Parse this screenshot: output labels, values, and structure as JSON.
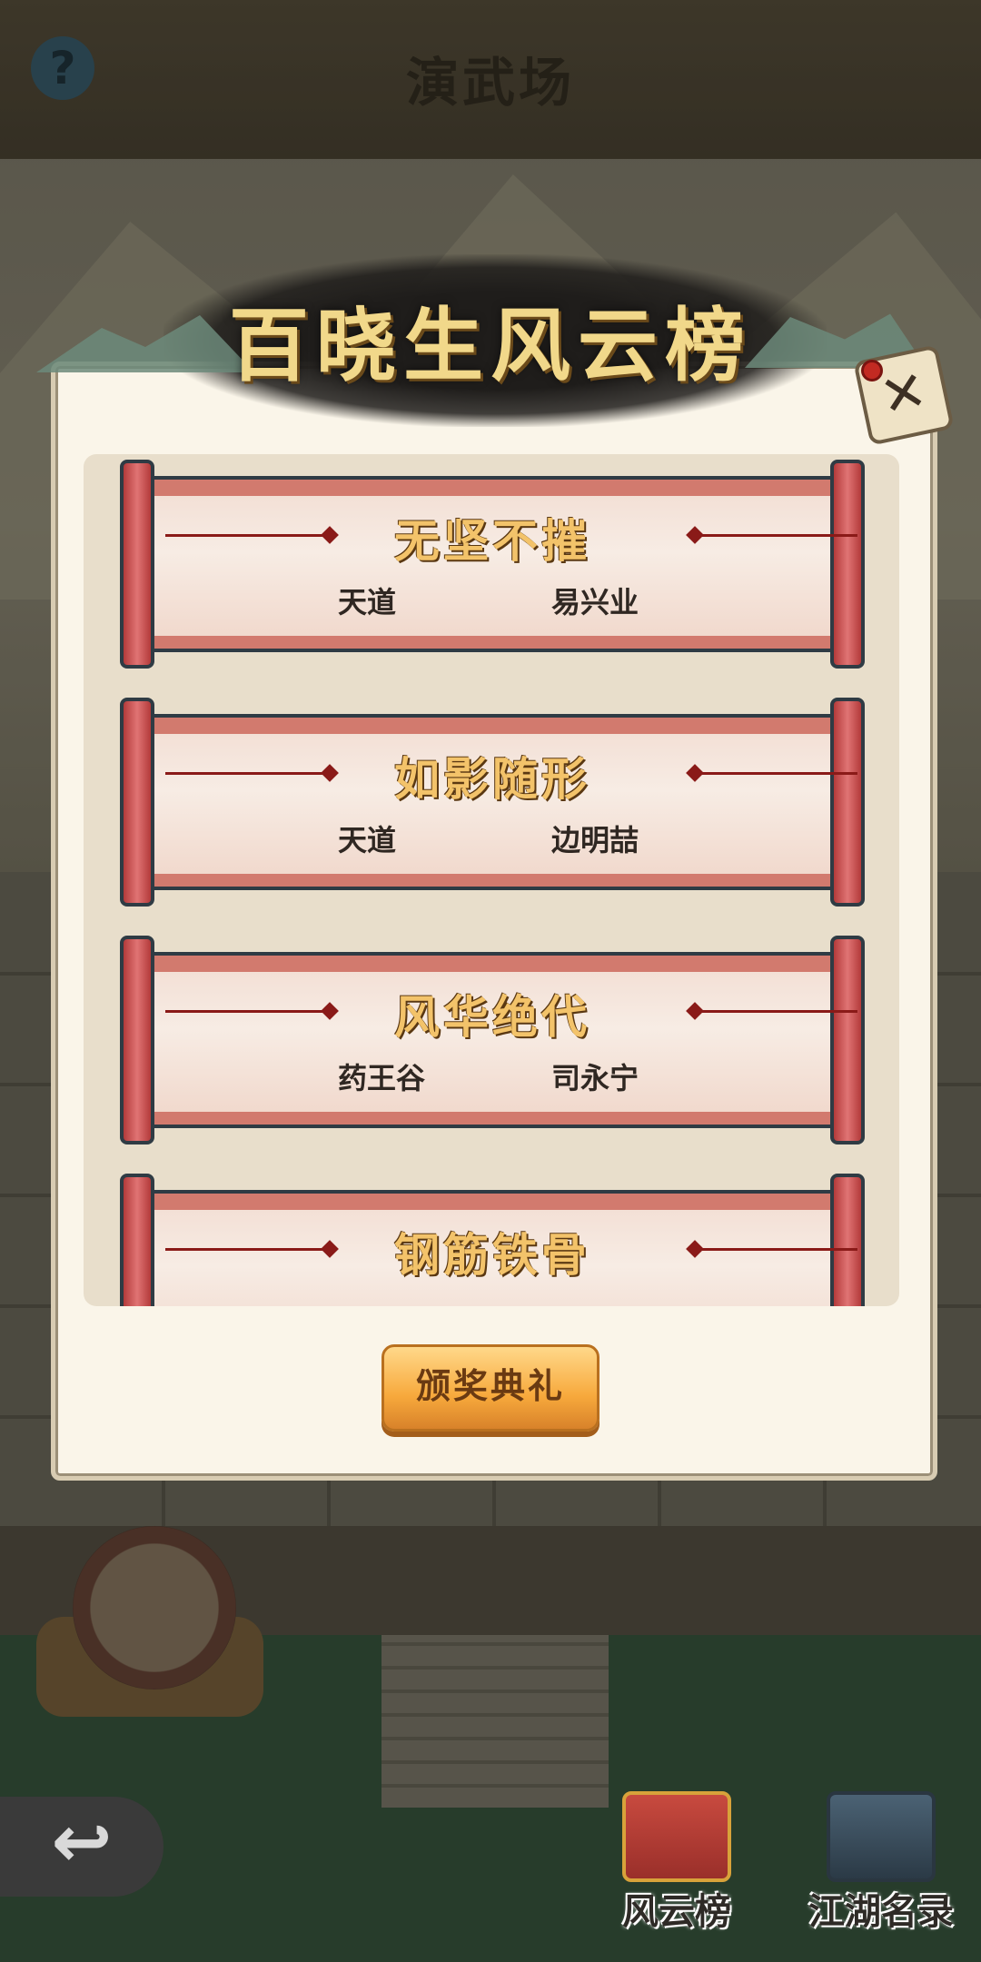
{
  "header": {
    "title": "演武场",
    "help_icon": "?"
  },
  "panel": {
    "title": "百晓生风云榜",
    "close_icon": "✕",
    "entries": [
      {
        "title": "无坚不摧",
        "sect": "天道",
        "name": "易兴业"
      },
      {
        "title": "如影随形",
        "sect": "天道",
        "name": "边明喆"
      },
      {
        "title": "风华绝代",
        "sect": "药王谷",
        "name": "司永宁"
      },
      {
        "title": "钢筋铁骨",
        "sect": "",
        "name": ""
      }
    ],
    "award_button": "颁奖典礼"
  },
  "bottom_nav": {
    "back_icon": "↩",
    "items": [
      {
        "label": "风云榜",
        "icon": "scroll-list-icon"
      },
      {
        "label": "江湖名录",
        "icon": "book-icon"
      }
    ]
  },
  "colors": {
    "accent": "#f7a93c",
    "scroll_red": "#d27a6e",
    "title_gold": "#f1d88a"
  }
}
